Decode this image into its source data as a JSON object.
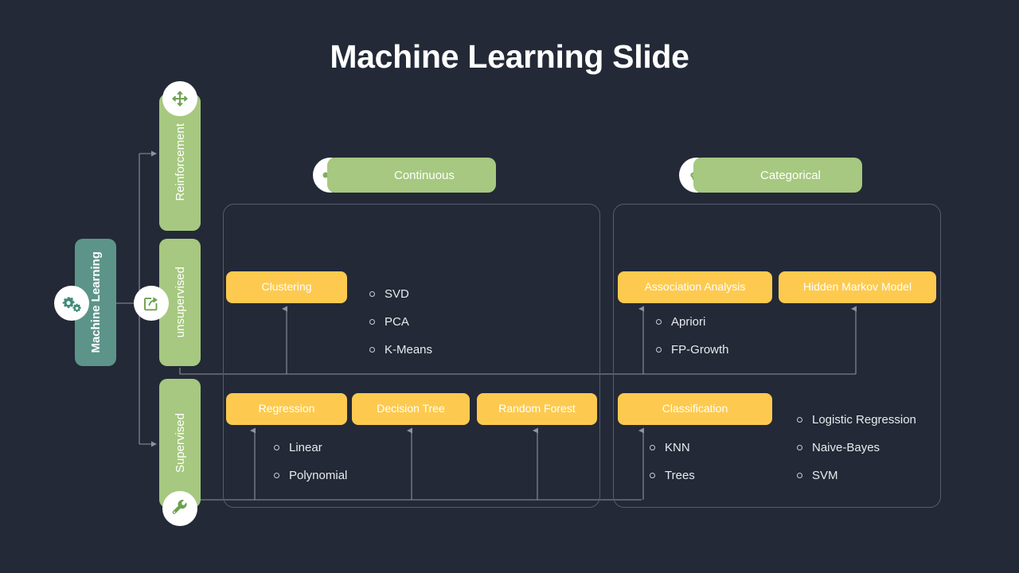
{
  "title": "Machine Learning Slide",
  "colors": {
    "background": "#232936",
    "teal": "#5d9489",
    "green": "#a6c880",
    "amber": "#fdca4f",
    "panel_border": "#555d6b",
    "text": "#ffffff",
    "bullet_text": "#e8eaee",
    "connector": "#8d939e"
  },
  "root": {
    "label": "Machine Learning",
    "icon": "gears-icon"
  },
  "branches": [
    {
      "label": "Reinforcement",
      "icon": "arrows-expand-icon"
    },
    {
      "label": "unsupervised",
      "icon": "share-export-icon"
    },
    {
      "label": "Supervised",
      "icon": "wrench-icon"
    }
  ],
  "categories": [
    {
      "label": "Continuous",
      "icon": "share-nodes-icon"
    },
    {
      "label": "Categorical",
      "icon": "sitemap-branch-icon"
    }
  ],
  "methods": {
    "clustering": "Clustering",
    "regression": "Regression",
    "decision_tree": "Decision Tree",
    "random_forest": "Random Forest",
    "association_analysis": "Association Analysis",
    "hidden_markov_model": "Hidden Markov Model",
    "classification": "Classification"
  },
  "lists": {
    "continuous_unsupervised": [
      "SVD",
      "PCA",
      "K-Means"
    ],
    "continuous_supervised": [
      "Linear",
      "Polynomial"
    ],
    "categorical_unsupervised": [
      "Apriori",
      "FP-Growth"
    ],
    "categorical_supervised_1": [
      "KNN",
      "Trees"
    ],
    "categorical_supervised_2": [
      "Logistic Regression",
      "Naive-Bayes",
      "SVM"
    ]
  }
}
